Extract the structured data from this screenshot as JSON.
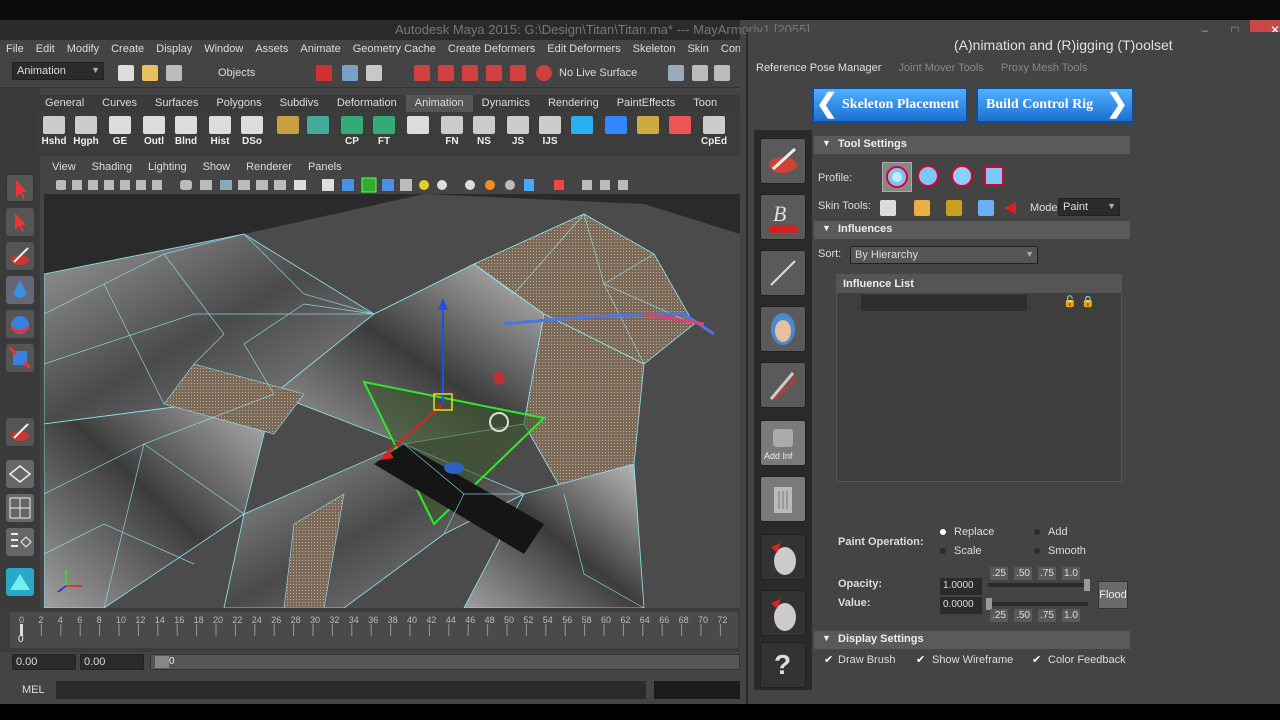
{
  "window": {
    "title": "Autodesk Maya 2015: G:\\Design\\Titan\\Titan.ma*   ---   MayArmor|v1 [2055]",
    "controls": [
      "–",
      "□",
      "✕"
    ]
  },
  "menubar": [
    "File",
    "Edit",
    "Modify",
    "Create",
    "Display",
    "Window",
    "Assets",
    "Animate",
    "Geometry Cache",
    "Create Deformers",
    "Edit Deformers",
    "Skeleton",
    "Skin",
    "Constrain"
  ],
  "statusline": {
    "menu_set": "Animation",
    "selection_mode": "Objects",
    "live_surface": "No Live Surface"
  },
  "shelf_tabs": [
    "General",
    "Curves",
    "Surfaces",
    "Polygons",
    "Subdivs",
    "Deformation",
    "Animation",
    "Dynamics",
    "Rendering",
    "PaintEffects",
    "Toon"
  ],
  "shelf_buttons": [
    "Hshd",
    "Hgph",
    "GE",
    "Outl",
    "Blnd",
    "Hist",
    "DSo",
    "",
    "",
    "CP",
    "FT",
    "",
    "FN",
    "NS",
    "JS",
    "IJS",
    "",
    "",
    "",
    "",
    "CpEd"
  ],
  "viewport_menu": [
    "View",
    "Shading",
    "Lighting",
    "Show",
    "Renderer",
    "Panels"
  ],
  "timeline": {
    "ticks": [
      "0",
      "2",
      "4",
      "6",
      "8",
      "10",
      "12",
      "14",
      "16",
      "18",
      "20",
      "22",
      "24",
      "26",
      "28",
      "30",
      "32",
      "34",
      "36",
      "38",
      "40",
      "42",
      "44",
      "46",
      "48",
      "50",
      "52",
      "54",
      "56",
      "58",
      "60",
      "62",
      "64",
      "66",
      "68",
      "70",
      "72"
    ],
    "current": "0"
  },
  "range": {
    "start": "0.00",
    "end": "0.00",
    "current": "0"
  },
  "command_line": {
    "label": "MEL"
  },
  "art": {
    "title": "(A)nimation and (R)igging (T)oolset",
    "tabs": [
      "Reference Pose Manager",
      "Joint Mover Tools",
      "Proxy Mesh Tools"
    ],
    "skeleton_placement": "Skeleton Placement",
    "build_control_rig": "Build Control Rig",
    "tool_settings": {
      "header": "Tool Settings",
      "profile_label": "Profile:",
      "skin_tools_label": "Skin Tools:",
      "mode_label": "Mode",
      "mode_value": "Paint"
    },
    "influences": {
      "header": "Influences",
      "sort_label": "Sort:",
      "sort_value": "By Hierarchy",
      "list_header": "Influence List"
    },
    "paint": {
      "label": "Paint Operation:",
      "replace": "Replace",
      "add": "Add",
      "scale": "Scale",
      "smooth": "Smooth",
      "opacity_label": "Opacity:",
      "opacity": "1.0000",
      "value_label": "Value:",
      "value": "0.0000",
      "presets": [
        ".25",
        ".50",
        ".75",
        "1.0"
      ],
      "flood": "Flood"
    },
    "display": {
      "header": "Display Settings",
      "draw_brush": "Draw Brush",
      "show_wireframe": "Show Wireframe",
      "color_feedback": "Color Feedback"
    },
    "side_buttons": {
      "add_inf": "Add Inf",
      "help": "?"
    }
  },
  "colors": {
    "accent_blue": "#2a86e8",
    "green_selection": "#2ee82e",
    "mesh_wire": "#8ee8f0"
  }
}
